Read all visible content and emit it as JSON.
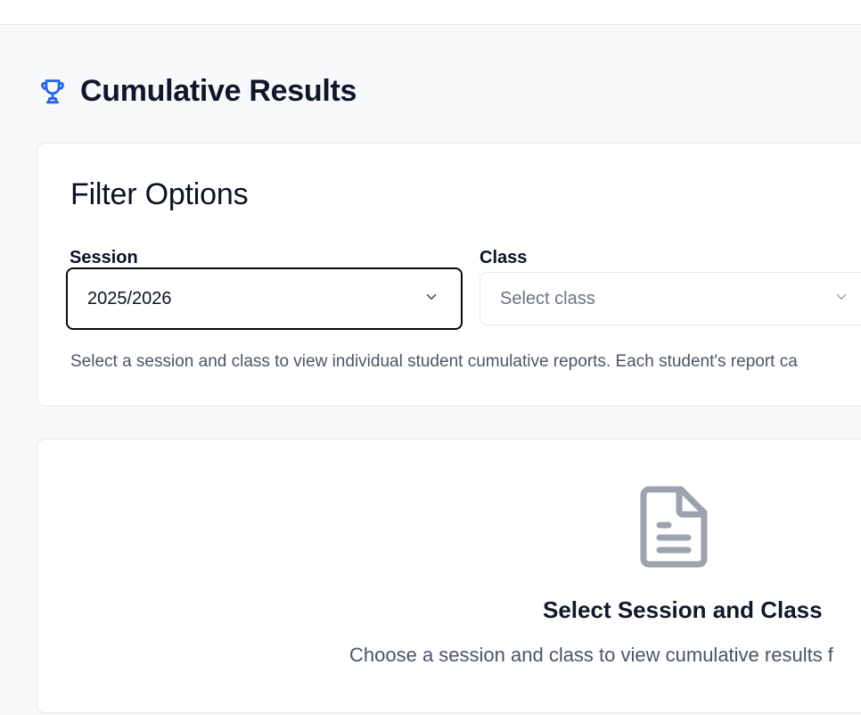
{
  "page": {
    "title": "Cumulative Results",
    "title_icon": "trophy-icon",
    "accent_color": "#2563eb"
  },
  "filter": {
    "title": "Filter Options",
    "session": {
      "label": "Session",
      "value": "2025/2026",
      "icon": "chevron-down-icon"
    },
    "class": {
      "label": "Class",
      "placeholder": "Select class",
      "icon": "chevron-down-icon"
    },
    "helper_text": "Select a session and class to view individual student cumulative reports. Each student's report ca"
  },
  "empty_state": {
    "icon": "document-icon",
    "title": "Select Session and Class",
    "text": "Choose a session and class to view cumulative results f"
  }
}
